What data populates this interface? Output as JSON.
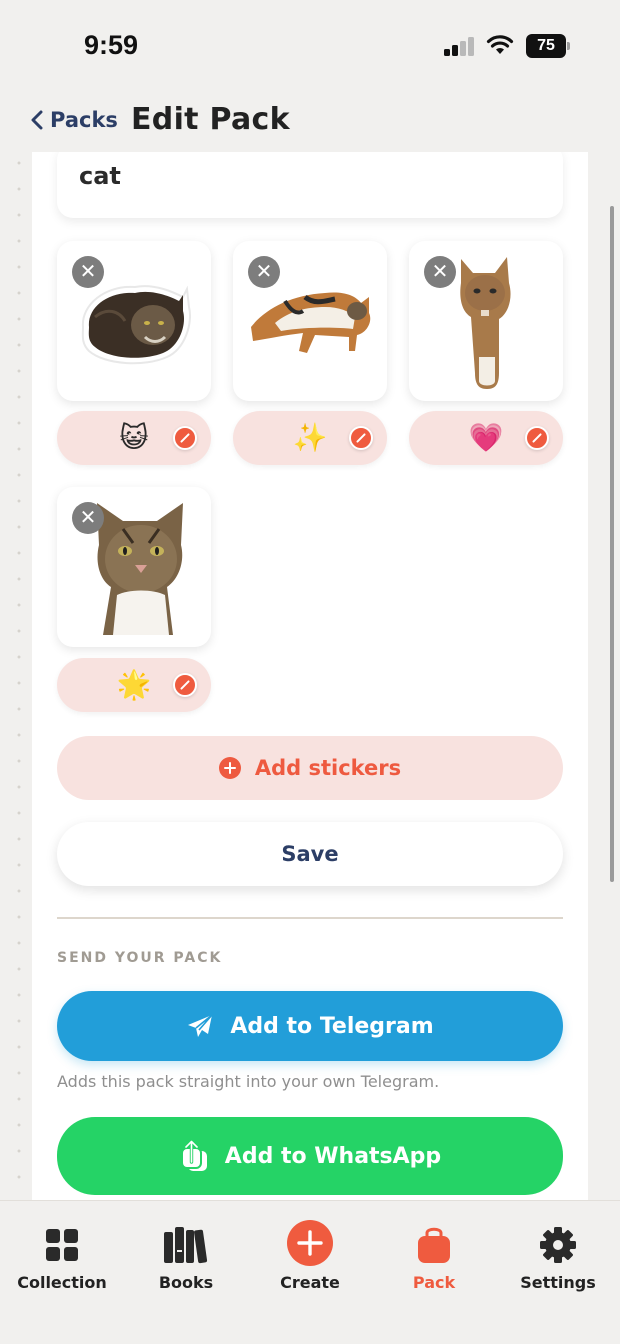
{
  "status_bar": {
    "time": "9:59",
    "battery": "75"
  },
  "header": {
    "back_label": "Packs",
    "title": "Edit Pack"
  },
  "pack": {
    "name": "cat"
  },
  "stickers": [
    {
      "emoji": "😺"
    },
    {
      "emoji": "✨"
    },
    {
      "emoji": "💗"
    },
    {
      "emoji": "🌟"
    }
  ],
  "actions": {
    "add_stickers": "Add stickers",
    "save": "Save"
  },
  "send": {
    "section_label": "SEND YOUR PACK",
    "telegram": "Add to Telegram",
    "telegram_hint": "Adds this pack straight into your own Telegram.",
    "whatsapp": "Add to WhatsApp"
  },
  "tabs": [
    {
      "label": "Collection",
      "icon": "grid-icon"
    },
    {
      "label": "Books",
      "icon": "books-icon"
    },
    {
      "label": "Create",
      "icon": "plus-circle-icon"
    },
    {
      "label": "Pack",
      "icon": "bag-icon",
      "active": true
    },
    {
      "label": "Settings",
      "icon": "gear-icon"
    }
  ],
  "colors": {
    "accent": "#ef5b3f",
    "telegram": "#229ed9",
    "whatsapp": "#25d366",
    "navy": "#2c3e66"
  }
}
